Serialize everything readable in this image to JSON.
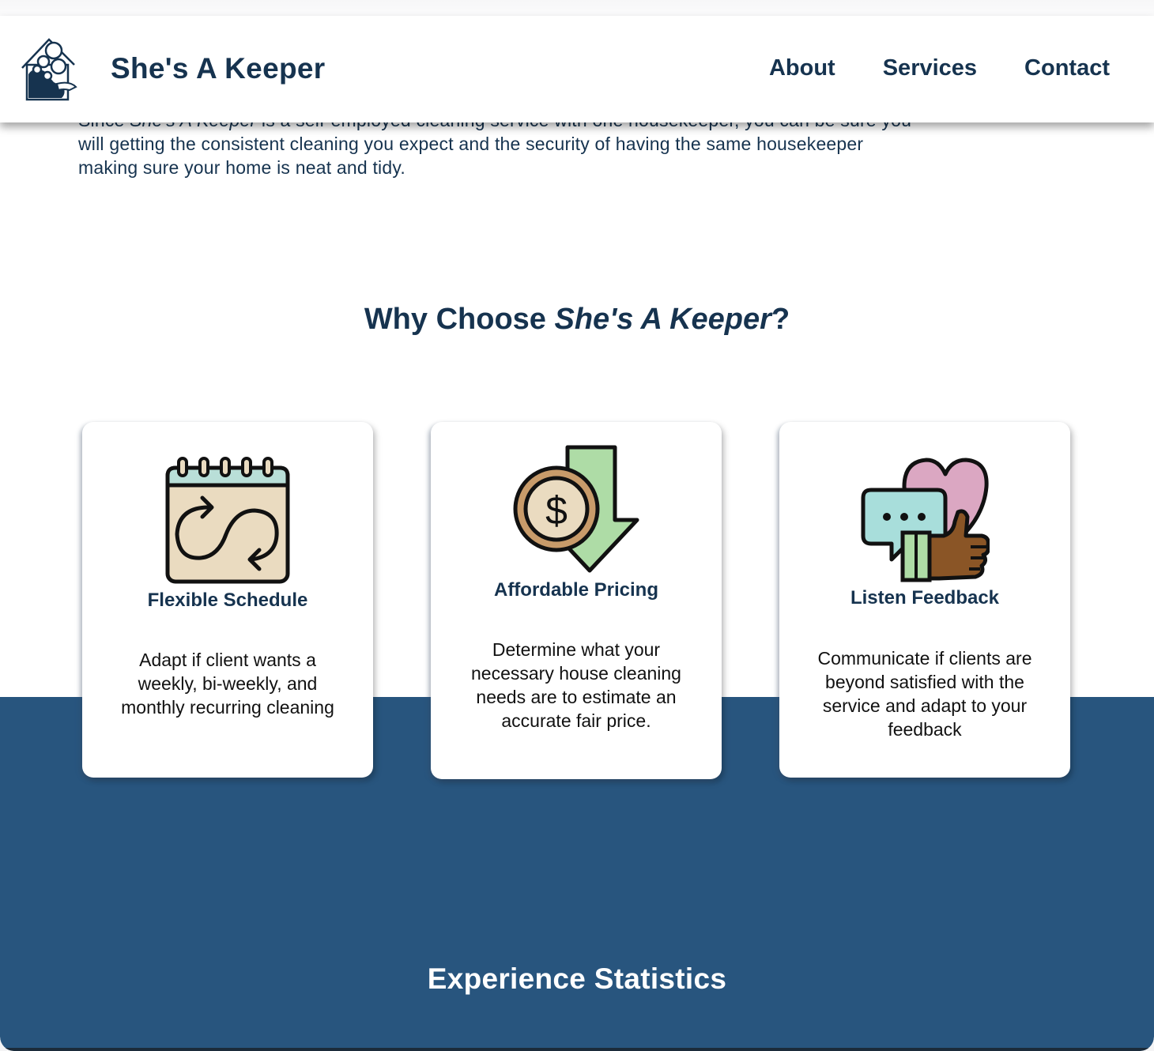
{
  "header": {
    "brand": "She's A Keeper",
    "nav": [
      "About",
      "Services",
      "Contact"
    ]
  },
  "intro": {
    "lead_before": "Since ",
    "lead_em": "She's A Keeper",
    "lead_after": " is a self-employed cleaning service with one housekeeper, you can be sure you",
    "line2": "will getting the consistent cleaning you expect and the security of having the same housekeeper",
    "line3": "making sure your home is neat and tidy."
  },
  "why": {
    "title_plain": "Why Choose ",
    "title_em": "She's A Keeper",
    "title_end": "?"
  },
  "cards": [
    {
      "icon": "calendar-repeat-icon",
      "title": "Flexible Schedule",
      "text": "Adapt if client wants a weekly, bi-weekly, and monthly recurring cleaning"
    },
    {
      "icon": "price-drop-coin-icon",
      "title": "Affordable Pricing",
      "text": "Determine what your necessary house cleaning needs are to estimate an accurate fair price."
    },
    {
      "icon": "feedback-thumbs-up-icon",
      "title": "Listen Feedback",
      "text": "Communicate if clients are beyond satisfied with the service and adapt to your feedback"
    }
  ],
  "stats": {
    "title": "Experience Statistics"
  },
  "colors": {
    "navy_text": "#16334f",
    "band_blue": "#28557e",
    "calendar_top": "#b9dfd8",
    "calendar_body": "#eadbc0",
    "arrow_green": "#aedca6",
    "coin_brown": "#c89b6a",
    "heart_pink": "#dba7c2",
    "bubble_teal": "#a8dedb",
    "hand_brown": "#8a5526"
  }
}
